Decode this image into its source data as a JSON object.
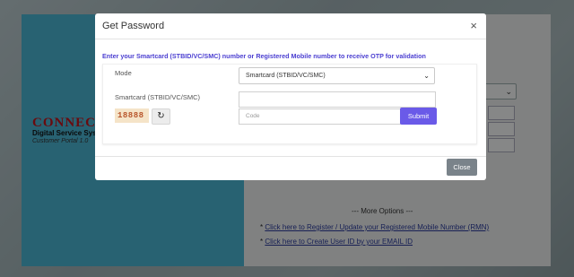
{
  "background": {
    "brand_title": "CONNEC",
    "brand_sub1": "Digital Service Sys",
    "brand_sub2": "Customer Portal 1.0",
    "select_chevron": "⌄",
    "more_options": "--- More Options ---",
    "link_bullet_1": "* ",
    "link_text_1": "Click here to Register / Update your Registered Mobile Number (RMN)",
    "link_bullet_2": "* ",
    "link_text_2": "Click here to Create User ID by your EMAIL ID"
  },
  "modal": {
    "title": "Get Password",
    "close_icon": "×",
    "instruction": "Enter your Smartcard (STBID/VC/SMC) number or Registered Mobile number to receive OTP for validation",
    "mode_label": "Mode",
    "mode_value": "Smartcard (STBID/VC/SMC)",
    "smartcard_label": "Smartcard (STBID/VC/SMC)",
    "smartcard_value": "",
    "captcha_text": "18888",
    "code_placeholder": "Code",
    "submit_label": "Submit",
    "close_button_label": "Close"
  },
  "colors": {
    "accent": "#6a5ae8",
    "instruction": "#4b3fd1",
    "brand_red": "#c0151c",
    "left_panel": "#4ab2cf"
  }
}
